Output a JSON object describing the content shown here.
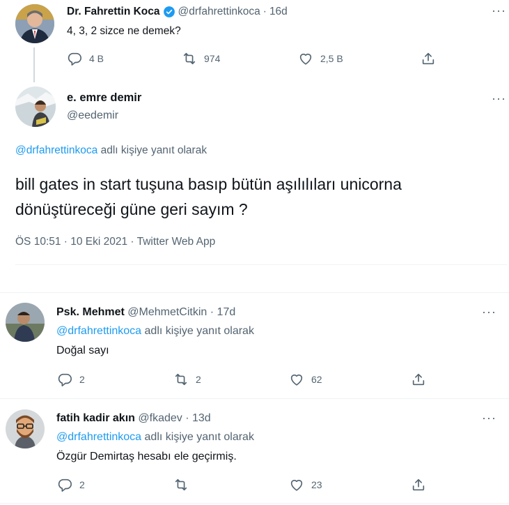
{
  "original": {
    "name": "Dr. Fahrettin Koca",
    "handle": "@drfahrettinkoca",
    "dot": "·",
    "time": "16d",
    "text": "4, 3, 2 sizce ne demek?",
    "reply_count": "4 B",
    "retweet_count": "974",
    "like_count": "2,5 B",
    "verified": true
  },
  "main": {
    "name": "e. emre demir",
    "handle": "@eedemir",
    "reply_to_handle": "@drfahrettinkoca",
    "reply_to_suffix": "adlı kişiye yanıt olarak",
    "text_line1": "bill gates in start tuşuna basıp bütün aşılılıları unicorna",
    "text_line2": "dönüştüreceği güne geri sayım ?",
    "meta": "ÖS 10:51 · 10 Eki 2021 · Twitter Web App"
  },
  "replies": [
    {
      "name": "Psk. Mehmet",
      "handle": "@MehmetCitkin",
      "dot": "·",
      "time": "17d",
      "reply_to_handle": "@drfahrettinkoca",
      "reply_to_suffix": "adlı kişiye yanıt olarak",
      "text": "Doğal sayı",
      "reply_count": "2",
      "retweet_count": "2",
      "like_count": "62"
    },
    {
      "name": "fatih kadir akın",
      "handle": "@fkadev",
      "dot": "·",
      "time": "13d",
      "reply_to_handle": "@drfahrettinkoca",
      "reply_to_suffix": "adlı kişiye yanıt olarak",
      "text": "Özgür Demirtaş hesabı ele geçirmiş.",
      "reply_count": "2",
      "retweet_count": "",
      "like_count": "23"
    }
  ],
  "colors": {
    "accent": "#1d9bf0",
    "secondary_text": "#536471",
    "divider": "#eff3f4"
  },
  "icons": [
    "verified-badge-icon",
    "more-icon",
    "reply-icon",
    "retweet-icon",
    "like-icon",
    "share-icon"
  ]
}
